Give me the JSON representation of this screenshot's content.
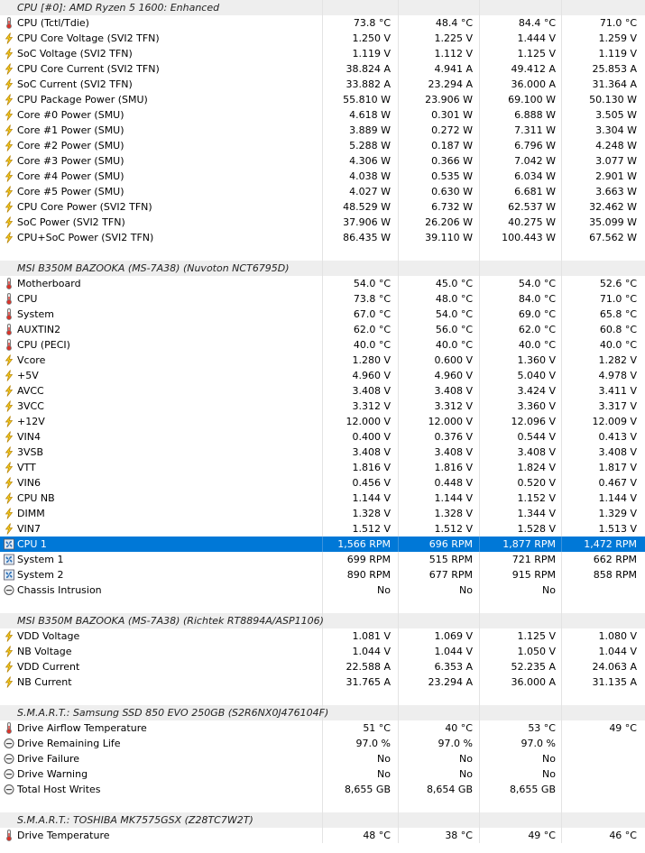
{
  "groups": [
    {
      "title": "CPU [#0]: AMD Ryzen 5 1600: Enhanced",
      "rows": [
        {
          "icon": "thermometer-icon",
          "name": "CPU (Tctl/Tdie)",
          "cur": "73.8 °C",
          "min": "48.4 °C",
          "max": "84.4 °C",
          "avg": "71.0 °C"
        },
        {
          "icon": "lightning-icon",
          "name": "CPU Core Voltage (SVI2 TFN)",
          "cur": "1.250 V",
          "min": "1.225 V",
          "max": "1.444 V",
          "avg": "1.259 V"
        },
        {
          "icon": "lightning-icon",
          "name": "SoC Voltage (SVI2 TFN)",
          "cur": "1.119 V",
          "min": "1.112 V",
          "max": "1.125 V",
          "avg": "1.119 V"
        },
        {
          "icon": "lightning-icon",
          "name": "CPU Core Current (SVI2 TFN)",
          "cur": "38.824 A",
          "min": "4.941 A",
          "max": "49.412 A",
          "avg": "25.853 A"
        },
        {
          "icon": "lightning-icon",
          "name": "SoC Current (SVI2 TFN)",
          "cur": "33.882 A",
          "min": "23.294 A",
          "max": "36.000 A",
          "avg": "31.364 A"
        },
        {
          "icon": "lightning-icon",
          "name": "CPU Package Power (SMU)",
          "cur": "55.810 W",
          "min": "23.906 W",
          "max": "69.100 W",
          "avg": "50.130 W"
        },
        {
          "icon": "lightning-icon",
          "name": "Core #0 Power (SMU)",
          "cur": "4.618 W",
          "min": "0.301 W",
          "max": "6.888 W",
          "avg": "3.505 W"
        },
        {
          "icon": "lightning-icon",
          "name": "Core #1 Power (SMU)",
          "cur": "3.889 W",
          "min": "0.272 W",
          "max": "7.311 W",
          "avg": "3.304 W"
        },
        {
          "icon": "lightning-icon",
          "name": "Core #2 Power (SMU)",
          "cur": "5.288 W",
          "min": "0.187 W",
          "max": "6.796 W",
          "avg": "4.248 W"
        },
        {
          "icon": "lightning-icon",
          "name": "Core #3 Power (SMU)",
          "cur": "4.306 W",
          "min": "0.366 W",
          "max": "7.042 W",
          "avg": "3.077 W"
        },
        {
          "icon": "lightning-icon",
          "name": "Core #4 Power (SMU)",
          "cur": "4.038 W",
          "min": "0.535 W",
          "max": "6.034 W",
          "avg": "2.901 W"
        },
        {
          "icon": "lightning-icon",
          "name": "Core #5 Power (SMU)",
          "cur": "4.027 W",
          "min": "0.630 W",
          "max": "6.681 W",
          "avg": "3.663 W"
        },
        {
          "icon": "lightning-icon",
          "name": "CPU Core Power (SVI2 TFN)",
          "cur": "48.529 W",
          "min": "6.732 W",
          "max": "62.537 W",
          "avg": "32.462 W"
        },
        {
          "icon": "lightning-icon",
          "name": "SoC Power (SVI2 TFN)",
          "cur": "37.906 W",
          "min": "26.206 W",
          "max": "40.275 W",
          "avg": "35.099 W"
        },
        {
          "icon": "lightning-icon",
          "name": "CPU+SoC Power (SVI2 TFN)",
          "cur": "86.435 W",
          "min": "39.110 W",
          "max": "100.443 W",
          "avg": "67.562 W"
        }
      ]
    },
    {
      "title": "MSI B350M BAZOOKA (MS-7A38) (Nuvoton NCT6795D)",
      "rows": [
        {
          "icon": "thermometer-icon",
          "name": "Motherboard",
          "cur": "54.0 °C",
          "min": "45.0 °C",
          "max": "54.0 °C",
          "avg": "52.6 °C"
        },
        {
          "icon": "thermometer-icon",
          "name": "CPU",
          "cur": "73.8 °C",
          "min": "48.0 °C",
          "max": "84.0 °C",
          "avg": "71.0 °C"
        },
        {
          "icon": "thermometer-icon",
          "name": "System",
          "cur": "67.0 °C",
          "min": "54.0 °C",
          "max": "69.0 °C",
          "avg": "65.8 °C"
        },
        {
          "icon": "thermometer-icon",
          "name": "AUXTIN2",
          "cur": "62.0 °C",
          "min": "56.0 °C",
          "max": "62.0 °C",
          "avg": "60.8 °C"
        },
        {
          "icon": "thermometer-icon",
          "name": "CPU (PECI)",
          "cur": "40.0 °C",
          "min": "40.0 °C",
          "max": "40.0 °C",
          "avg": "40.0 °C"
        },
        {
          "icon": "lightning-icon",
          "name": "Vcore",
          "cur": "1.280 V",
          "min": "0.600 V",
          "max": "1.360 V",
          "avg": "1.282 V"
        },
        {
          "icon": "lightning-icon",
          "name": "+5V",
          "cur": "4.960 V",
          "min": "4.960 V",
          "max": "5.040 V",
          "avg": "4.978 V"
        },
        {
          "icon": "lightning-icon",
          "name": "AVCC",
          "cur": "3.408 V",
          "min": "3.408 V",
          "max": "3.424 V",
          "avg": "3.411 V"
        },
        {
          "icon": "lightning-icon",
          "name": "3VCC",
          "cur": "3.312 V",
          "min": "3.312 V",
          "max": "3.360 V",
          "avg": "3.317 V"
        },
        {
          "icon": "lightning-icon",
          "name": "+12V",
          "cur": "12.000 V",
          "min": "12.000 V",
          "max": "12.096 V",
          "avg": "12.009 V"
        },
        {
          "icon": "lightning-icon",
          "name": "VIN4",
          "cur": "0.400 V",
          "min": "0.376 V",
          "max": "0.544 V",
          "avg": "0.413 V"
        },
        {
          "icon": "lightning-icon",
          "name": "3VSB",
          "cur": "3.408 V",
          "min": "3.408 V",
          "max": "3.408 V",
          "avg": "3.408 V"
        },
        {
          "icon": "lightning-icon",
          "name": "VTT",
          "cur": "1.816 V",
          "min": "1.816 V",
          "max": "1.824 V",
          "avg": "1.817 V"
        },
        {
          "icon": "lightning-icon",
          "name": "VIN6",
          "cur": "0.456 V",
          "min": "0.448 V",
          "max": "0.520 V",
          "avg": "0.467 V"
        },
        {
          "icon": "lightning-icon",
          "name": "CPU NB",
          "cur": "1.144 V",
          "min": "1.144 V",
          "max": "1.152 V",
          "avg": "1.144 V"
        },
        {
          "icon": "lightning-icon",
          "name": "DIMM",
          "cur": "1.328 V",
          "min": "1.328 V",
          "max": "1.344 V",
          "avg": "1.329 V"
        },
        {
          "icon": "lightning-icon",
          "name": "VIN7",
          "cur": "1.512 V",
          "min": "1.512 V",
          "max": "1.528 V",
          "avg": "1.513 V"
        },
        {
          "icon": "fan-icon",
          "name": "CPU 1",
          "cur": "1,566 RPM",
          "min": "696 RPM",
          "max": "1,877 RPM",
          "avg": "1,472 RPM",
          "selected": true
        },
        {
          "icon": "fan-icon",
          "name": "System 1",
          "cur": "699 RPM",
          "min": "515 RPM",
          "max": "721 RPM",
          "avg": "662 RPM"
        },
        {
          "icon": "fan-icon",
          "name": "System 2",
          "cur": "890 RPM",
          "min": "677 RPM",
          "max": "915 RPM",
          "avg": "858 RPM"
        },
        {
          "icon": "circle-minus-icon",
          "name": "Chassis Intrusion",
          "cur": "No",
          "min": "No",
          "max": "No",
          "avg": ""
        }
      ]
    },
    {
      "title": "MSI B350M BAZOOKA (MS-7A38) (Richtek RT8894A/ASP1106)",
      "rows": [
        {
          "icon": "lightning-icon",
          "name": "VDD Voltage",
          "cur": "1.081 V",
          "min": "1.069 V",
          "max": "1.125 V",
          "avg": "1.080 V"
        },
        {
          "icon": "lightning-icon",
          "name": "NB Voltage",
          "cur": "1.044 V",
          "min": "1.044 V",
          "max": "1.050 V",
          "avg": "1.044 V"
        },
        {
          "icon": "lightning-icon",
          "name": "VDD Current",
          "cur": "22.588 A",
          "min": "6.353 A",
          "max": "52.235 A",
          "avg": "24.063 A"
        },
        {
          "icon": "lightning-icon",
          "name": "NB Current",
          "cur": "31.765 A",
          "min": "23.294 A",
          "max": "36.000 A",
          "avg": "31.135 A"
        }
      ]
    },
    {
      "title": "S.M.A.R.T.: Samsung SSD 850 EVO 250GB (S2R6NX0J476104F)",
      "rows": [
        {
          "icon": "thermometer-icon",
          "name": "Drive Airflow Temperature",
          "cur": "51 °C",
          "min": "40 °C",
          "max": "53 °C",
          "avg": "49 °C"
        },
        {
          "icon": "circle-minus-icon",
          "name": "Drive Remaining Life",
          "cur": "97.0 %",
          "min": "97.0 %",
          "max": "97.0 %",
          "avg": ""
        },
        {
          "icon": "circle-minus-icon",
          "name": "Drive Failure",
          "cur": "No",
          "min": "No",
          "max": "No",
          "avg": ""
        },
        {
          "icon": "circle-minus-icon",
          "name": "Drive Warning",
          "cur": "No",
          "min": "No",
          "max": "No",
          "avg": ""
        },
        {
          "icon": "circle-minus-icon",
          "name": "Total Host Writes",
          "cur": "8,655 GB",
          "min": "8,654 GB",
          "max": "8,655 GB",
          "avg": ""
        }
      ]
    },
    {
      "title": "S.M.A.R.T.: TOSHIBA MK7575GSX (Z28TC7W2T)",
      "rows": [
        {
          "icon": "thermometer-icon",
          "name": "Drive Temperature",
          "cur": "48 °C",
          "min": "38 °C",
          "max": "49 °C",
          "avg": "46 °C"
        }
      ]
    }
  ]
}
